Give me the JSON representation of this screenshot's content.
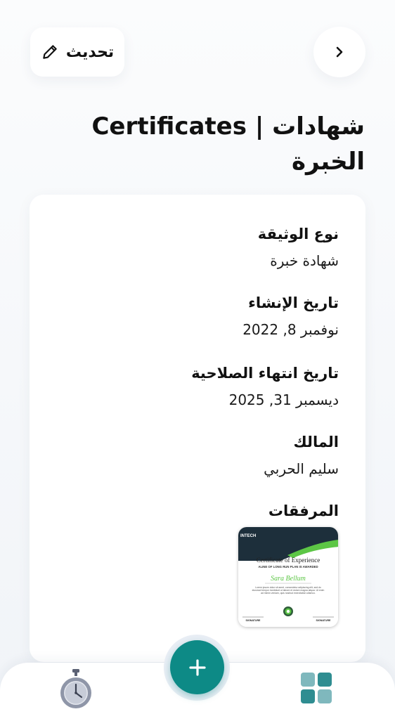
{
  "header": {
    "edit_label": "تحديث",
    "edit_icon": "pencil-icon",
    "back_icon": "chevron-right-icon",
    "title": "شهادات | Certificates الخبرة"
  },
  "fields": [
    {
      "label": "نوع الوثيقة",
      "value": "شهادة خبرة"
    },
    {
      "label": "تاريخ الإنشاء",
      "value": "نوفمبر 8, 2022"
    },
    {
      "label": "تاريخ انتهاء الصلاحية",
      "value": "ديسمبر 31, 2025"
    },
    {
      "label": "المالك",
      "value": "سليم الحربي"
    }
  ],
  "attachments": {
    "label": "المرفقات",
    "certificate": {
      "brand": "INTECH",
      "title": "Certificate of Experience",
      "subtitle": "ALINE OF LONG RUN PLAN IS AWARDED",
      "name": "Sara Bellum",
      "body": "Lorem ipsum dolor sit amet, consectetur adipiscing elit, sed do eiusmod tempor incididunt ut labore et dolore magna aliqua. Ut enim ad minim veniam, quis nostrud exercitation ullamco.",
      "signature_left": "SIGNATURE",
      "signature_right": "SIGNATURE"
    }
  },
  "bottom_nav": {
    "left_icon": "stopwatch-icon",
    "center_icon": "plus-icon",
    "right_icon": "grid-icon"
  },
  "colors": {
    "accent": "#0d8a86",
    "cert_dark": "#1d2f3b",
    "cert_green": "#5cc645",
    "timer_gray": "#8f96a8",
    "grid_teal": "#2f8d91"
  }
}
